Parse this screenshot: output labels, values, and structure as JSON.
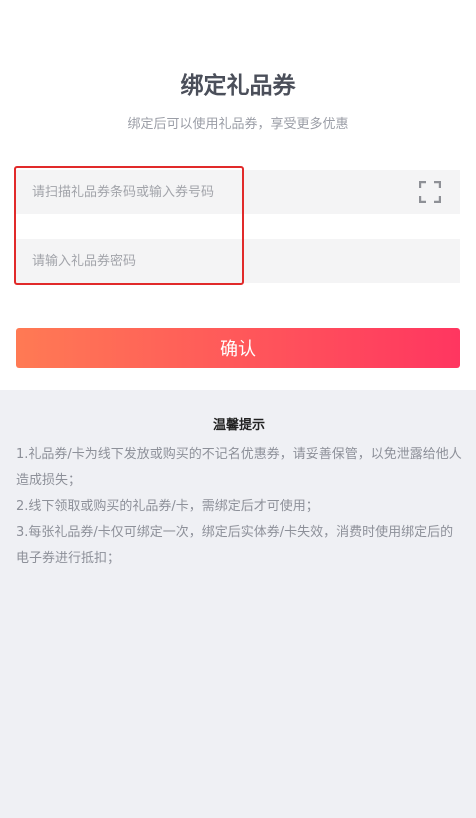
{
  "page": {
    "title": "绑定礼品券",
    "subtitle": "绑定后可以使用礼品券，享受更多优惠"
  },
  "form": {
    "code_placeholder": "请扫描礼品券条码或输入券号码",
    "code_value": "",
    "password_placeholder": "请输入礼品券密码",
    "password_value": "",
    "scan_icon": "scan-icon",
    "confirm_label": "确认"
  },
  "tips": {
    "title": "温馨提示",
    "items": [
      "1.礼品券/卡为线下发放或购买的不记名优惠券，请妥善保管，以免泄露给他人造成损失；",
      "2.线下领取或购买的礼品券/卡，需绑定后才可使用；",
      "3.每张礼品券/卡仅可绑定一次，绑定后实体券/卡失效，消费时使用绑定后的电子券进行抵扣；"
    ]
  },
  "colors": {
    "accent_start": "#ff7a54",
    "accent_end": "#ff3660",
    "highlight_border": "#e12a2a",
    "page_background": "#eff0f4"
  }
}
